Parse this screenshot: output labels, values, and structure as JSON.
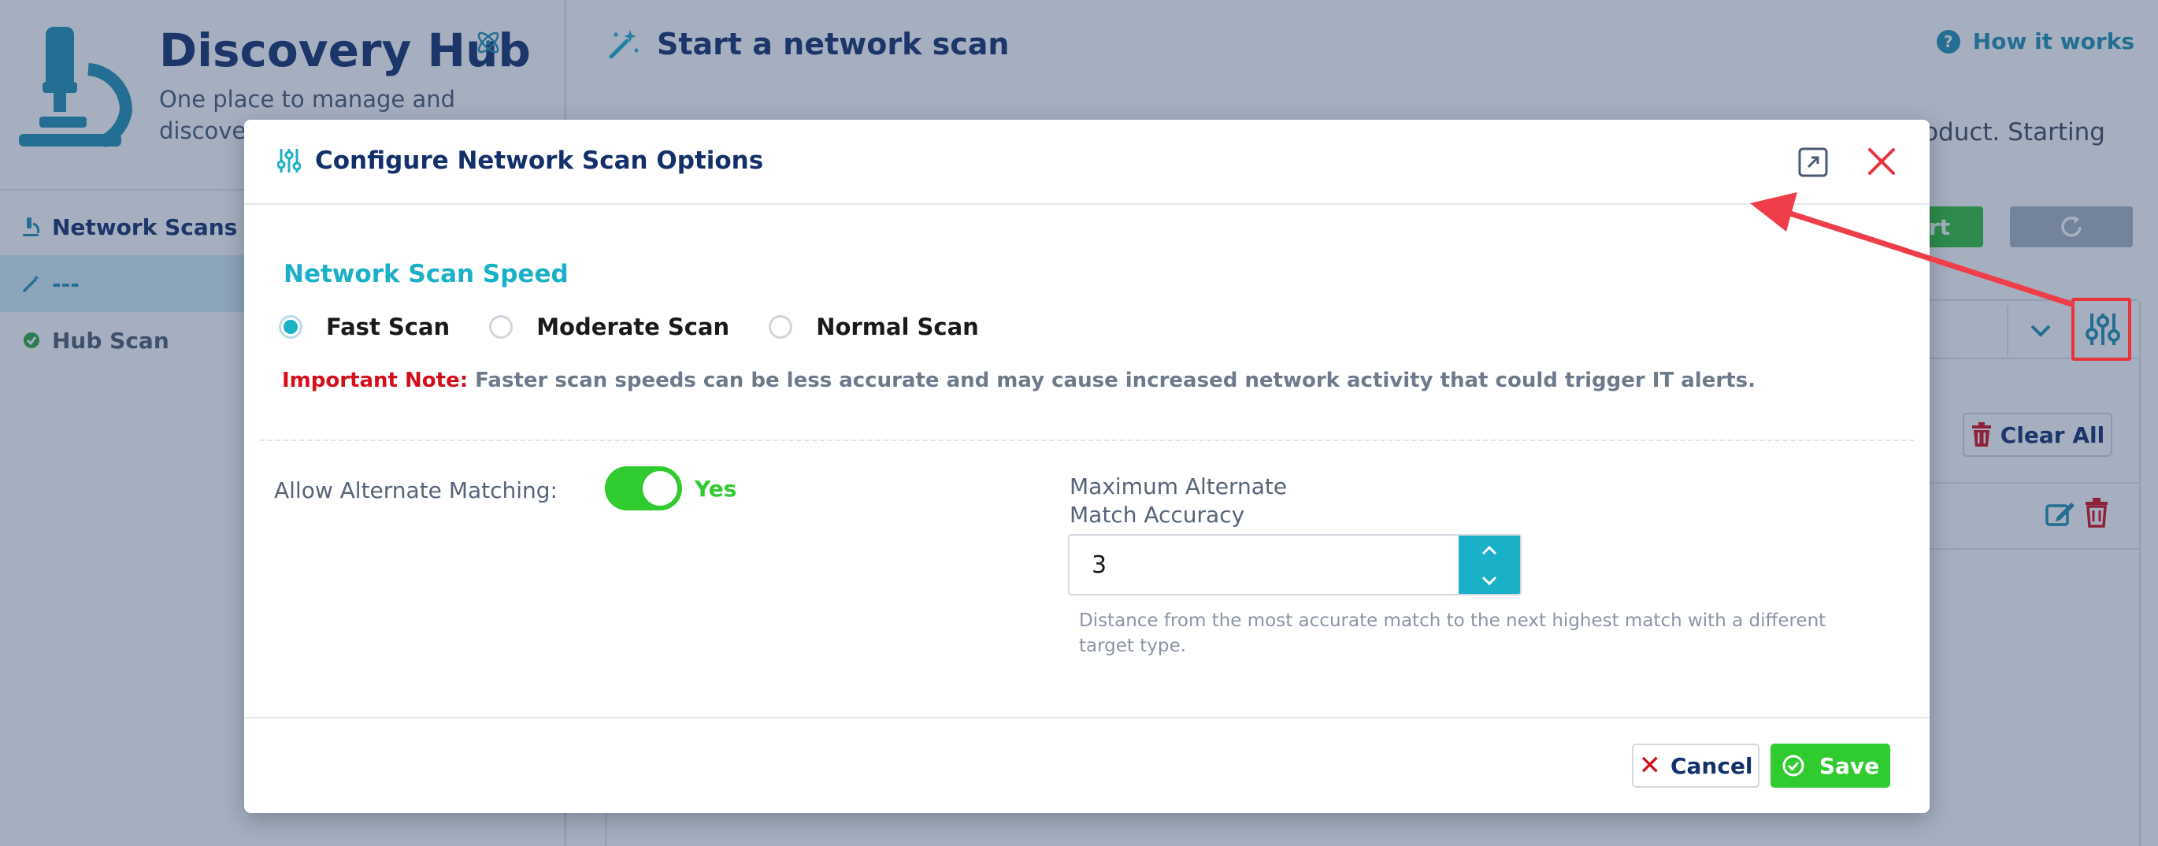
{
  "app": {
    "title": "Discovery Hub",
    "subtitle": "One place to manage and discover your IT In"
  },
  "sidebar": {
    "items": [
      {
        "label": "Network Scans",
        "icon": "microscope-icon"
      },
      {
        "label": "---",
        "icon": "magic-wand-icon"
      },
      {
        "label": "Hub Scan",
        "icon": "check-circle-icon"
      }
    ]
  },
  "main": {
    "title": "Start a network scan",
    "how_it_works": "How it works",
    "description_tail": "roduct. Starting",
    "start_label": "art",
    "clear_all": "Clear All"
  },
  "modal": {
    "title": "Configure Network Scan Options",
    "speed_section": "Network Scan Speed",
    "speed_options": [
      {
        "label": "Fast Scan",
        "selected": true
      },
      {
        "label": "Moderate Scan",
        "selected": false
      },
      {
        "label": "Normal Scan",
        "selected": false
      }
    ],
    "note_label": "Important Note:",
    "note_text": "Faster scan speeds can be less accurate and may cause increased network activity that could trigger IT alerts.",
    "alt_matching_label": "Allow Alternate Matching:",
    "alt_matching_on": true,
    "alt_matching_value": "Yes",
    "max_distance_label": "Maximum Alternate Match Accuracy Distance:",
    "max_distance_value": "3",
    "max_distance_help": "Distance from the most accurate match to the next highest match with a different target type.",
    "cancel_label": "Cancel",
    "save_label": "Save"
  },
  "colors": {
    "brand_navy": "#14306b",
    "accent_teal": "#1ab0c8",
    "success_green": "#2fcb2f",
    "danger_red": "#d40f1a",
    "annotation_red": "#e8333a"
  }
}
